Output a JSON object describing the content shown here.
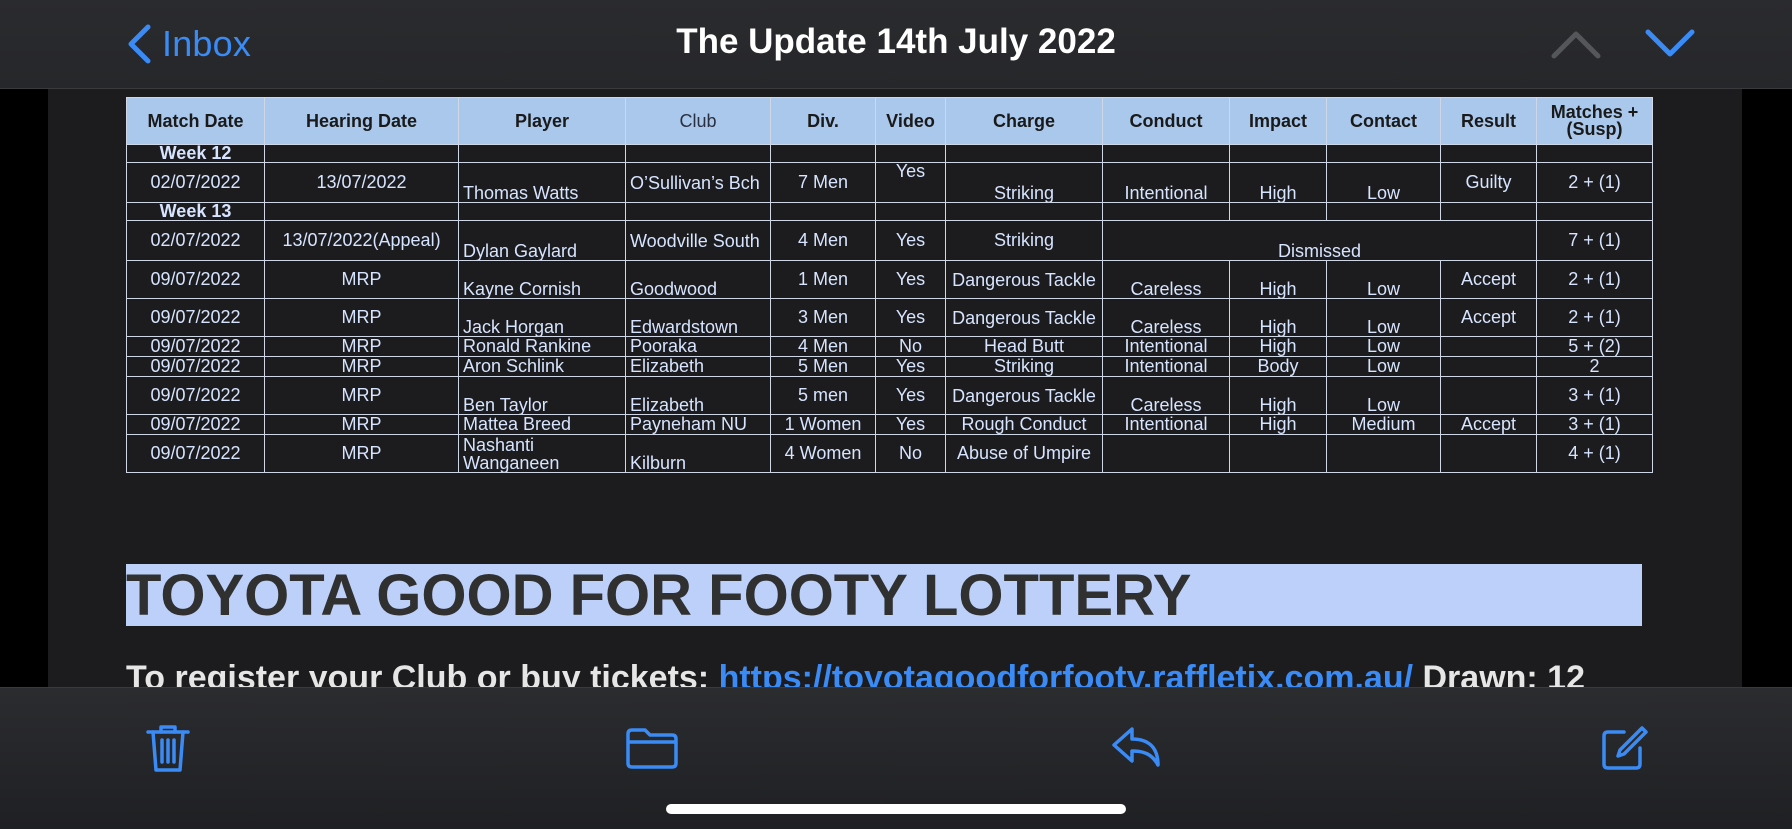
{
  "nav": {
    "back_label": "Inbox",
    "title": "The Update 14th July 2022",
    "prev_icon": "chevron-up-icon",
    "next_icon": "chevron-down-icon"
  },
  "table": {
    "headers": [
      "Match Date",
      "Hearing Date",
      "Player",
      "Club",
      "Div.",
      "Video",
      "Charge",
      "Conduct",
      "Impact",
      "Contact",
      "Result",
      "Matches + (Susp)"
    ],
    "rows": [
      {
        "type": "week",
        "label": "Week 12"
      },
      {
        "cells": [
          "02/07/2022",
          "13/07/2022",
          "Thomas Watts",
          "O’Sullivan’s Bch",
          "7 Men",
          "Yes",
          "Striking",
          "Intentional",
          "High",
          "Low",
          "Guilty",
          "2 + (1)"
        ]
      },
      {
        "type": "week",
        "label": "Week 13"
      },
      {
        "cells": [
          "02/07/2022",
          "13/07/2022(Appeal)",
          "Dylan Gaylard",
          "Woodville South",
          "4 Men",
          "Yes",
          "Striking",
          "Dismissed",
          "",
          "",
          "",
          "7 + (1)"
        ]
      },
      {
        "cells": [
          "09/07/2022",
          "MRP",
          "Kayne Cornish",
          "Goodwood",
          "1 Men",
          "Yes",
          "Dangerous Tackle",
          "Careless",
          "High",
          "Low",
          "Accept",
          "2 + (1)"
        ]
      },
      {
        "cells": [
          "09/07/2022",
          "MRP",
          "Jack Horgan",
          "Edwardstown",
          "3 Men",
          "Yes",
          "Dangerous Tackle",
          "Careless",
          "High",
          "Low",
          "Accept",
          "2 + (1)"
        ]
      },
      {
        "cells": [
          "09/07/2022",
          "MRP",
          "Ronald Rankine",
          "Pooraka",
          "4 Men",
          "No",
          "Head Butt",
          "Intentional",
          "High",
          "Low",
          "",
          "5 + (2)"
        ]
      },
      {
        "cells": [
          "09/07/2022",
          "MRP",
          "Aron Schlink",
          "Elizabeth",
          "5 Men",
          "Yes",
          "Striking",
          "Intentional",
          "Body",
          "Low",
          "",
          "2"
        ]
      },
      {
        "cells": [
          "09/07/2022",
          "MRP",
          "Ben Taylor",
          "Elizabeth",
          "5 men",
          "Yes",
          "Dangerous Tackle",
          "Careless",
          "High",
          "Low",
          "",
          "3 + (1)"
        ]
      },
      {
        "cells": [
          "09/07/2022",
          "MRP",
          "Mattea Breed",
          "Payneham NU",
          "1 Women",
          "Yes",
          "Rough Conduct",
          "Intentional",
          "High",
          "Medium",
          "Accept",
          "3 + (1)"
        ]
      },
      {
        "cells": [
          "09/07/2022",
          "MRP",
          "Nashanti Wanganeen",
          "Kilburn",
          "4 Women",
          "No",
          "Abuse of Umpire",
          "",
          "",
          "",
          "",
          "4 + (1)"
        ]
      }
    ]
  },
  "lottery": {
    "heading": "TOYOTA GOOD FOR FOOTY LOTTERY",
    "register_text": "To register your Club or buy tickets: ",
    "register_link": "https://toyotagoodforfooty.raffletix.com.au/",
    "drawn_text": " Drawn:  12"
  },
  "toolbar": {
    "icons": [
      "trash-icon",
      "folder-icon",
      "reply-icon",
      "compose-icon"
    ]
  },
  "colors": {
    "accent": "#3a8bf5",
    "header_bg": "#a9c8ec",
    "highlight": "#bcd0fa"
  }
}
